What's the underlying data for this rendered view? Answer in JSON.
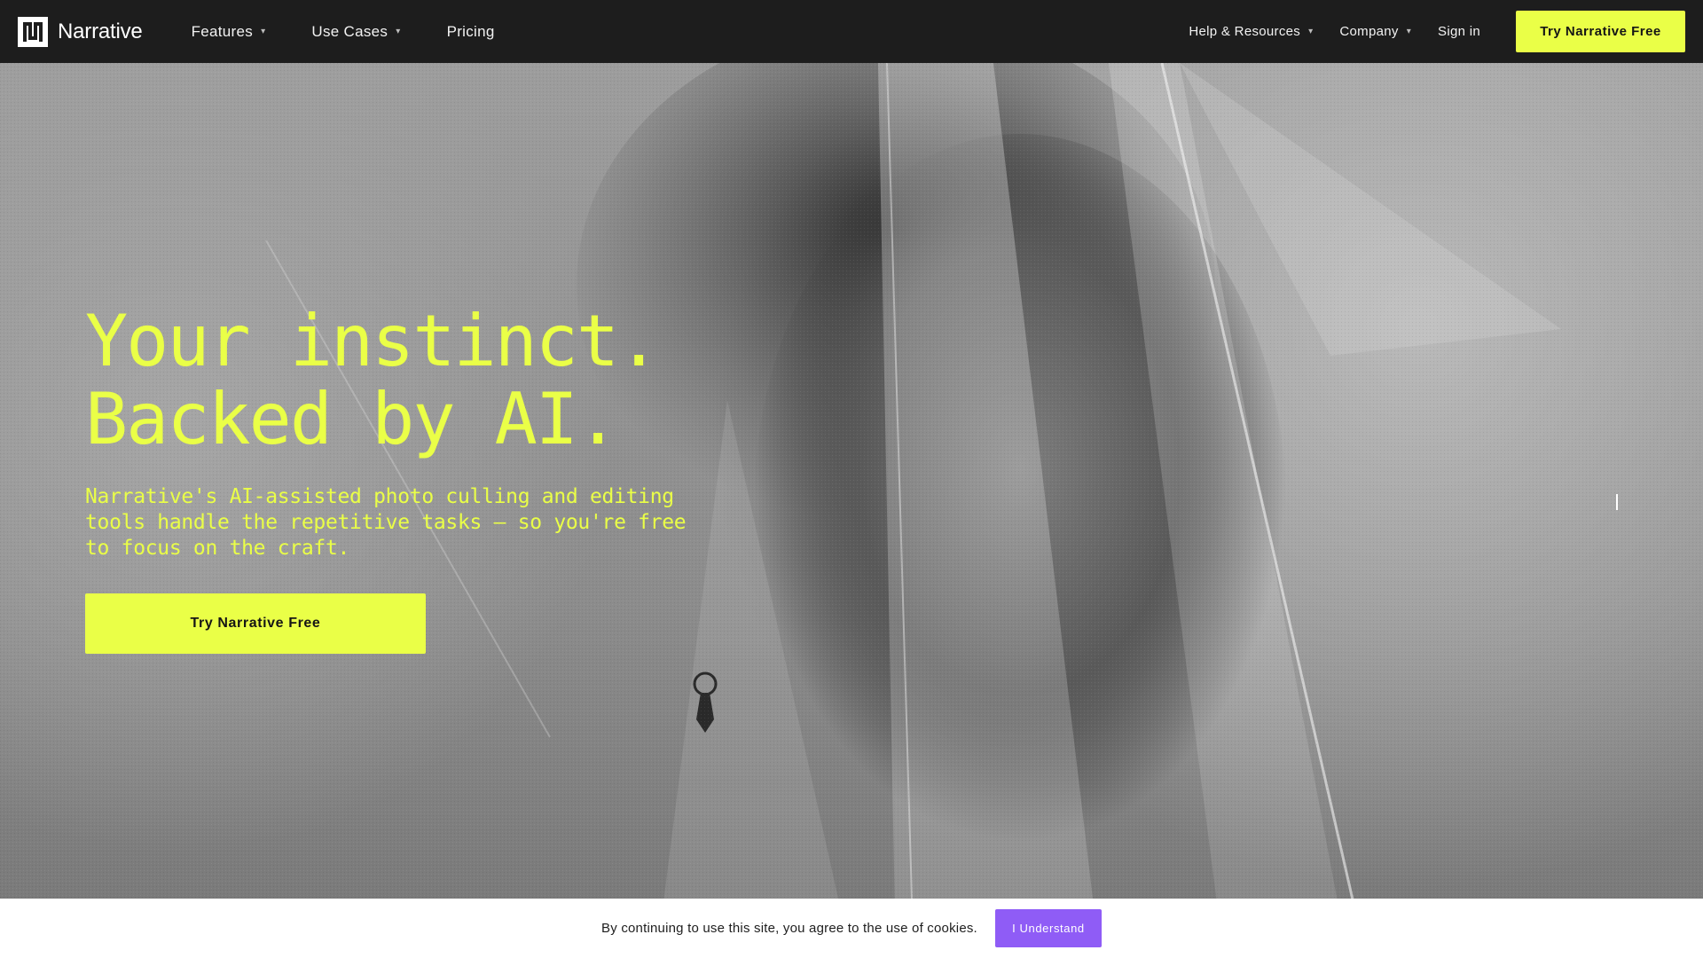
{
  "brand": {
    "name": "Narrative",
    "logo_icon": "narrative-logo-icon"
  },
  "nav": {
    "left": [
      {
        "label": "Features",
        "has_dropdown": true
      },
      {
        "label": "Use Cases",
        "has_dropdown": true
      },
      {
        "label": "Pricing",
        "has_dropdown": false
      }
    ],
    "right": [
      {
        "label": "Help & Resources",
        "has_dropdown": true
      },
      {
        "label": "Company",
        "has_dropdown": true
      },
      {
        "label": "Sign in",
        "has_dropdown": false
      }
    ],
    "cta_label": "Try Narrative Free",
    "dropdown_icon": "▾"
  },
  "hero": {
    "headline_line1": "Your instinct.",
    "headline_line2": "Backed by AI.",
    "subhead": "Narrative's AI-assisted photo culling and editing tools handle the repetitive tasks — so you're free to focus on the craft.",
    "cta_label": "Try Narrative Free",
    "background_image": "black-and-white photo of a bride with a veil"
  },
  "cookie_banner": {
    "text": "By continuing to use this site, you agree to the use of cookies.",
    "button_label": "I Understand"
  },
  "colors": {
    "accent": "#eaff47",
    "nav_background": "#1d1d1d",
    "cookie_button": "#8f5cf6",
    "cookie_background": "#ffffff"
  }
}
